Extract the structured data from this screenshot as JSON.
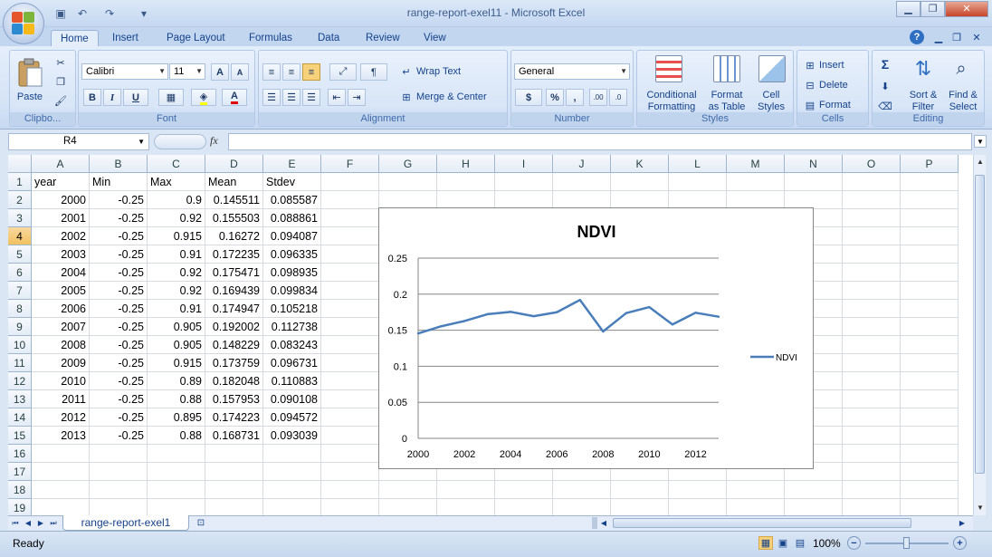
{
  "window": {
    "title": "range-report-exel11 - Microsoft Excel",
    "minimize": "▁",
    "restore": "❐",
    "close": "✕"
  },
  "tabs": [
    "Home",
    "Insert",
    "Page Layout",
    "Formulas",
    "Data",
    "Review",
    "View"
  ],
  "ribbon": {
    "clipboard": {
      "label": "Clipbo...",
      "paste": "Paste"
    },
    "font": {
      "label": "Font",
      "name": "Calibri",
      "size": "11",
      "bold": "B",
      "italic": "I",
      "underline": "U",
      "grow": "A",
      "shrink": "A",
      "fontcolor": "A"
    },
    "alignment": {
      "label": "Alignment",
      "wrap": "Wrap Text",
      "merge": "Merge & Center"
    },
    "number": {
      "label": "Number",
      "format": "General",
      "currency": "$",
      "percent": "%",
      "comma": ",",
      "inc": ".00",
      "dec": ".0"
    },
    "styles": {
      "label": "Styles",
      "conditional_1": "Conditional",
      "conditional_2": "Formatting",
      "table_1": "Format",
      "table_2": "as Table",
      "cell_1": "Cell",
      "cell_2": "Styles"
    },
    "cells": {
      "label": "Cells",
      "insert": "Insert",
      "delete": "Delete",
      "format": "Format"
    },
    "editing": {
      "label": "Editing",
      "sigma": "Σ",
      "sort_1": "Sort &",
      "sort_2": "Filter",
      "find_1": "Find &",
      "find_2": "Select"
    }
  },
  "formula_bar": {
    "name_box": "R4",
    "fx": "fx",
    "formula": ""
  },
  "columns": [
    "A",
    "B",
    "C",
    "D",
    "E",
    "F",
    "G",
    "H",
    "I",
    "J",
    "K",
    "L",
    "M",
    "N",
    "O",
    "P"
  ],
  "rows": [
    "1",
    "2",
    "3",
    "4",
    "5",
    "6",
    "7",
    "8",
    "9",
    "10",
    "11",
    "12",
    "13",
    "14",
    "15",
    "16",
    "17",
    "18",
    "19"
  ],
  "headers": [
    "year",
    "Min",
    "Max",
    "Mean",
    "Stdev"
  ],
  "table": [
    [
      "2000",
      "-0.25",
      "0.9",
      "0.145511",
      "0.085587"
    ],
    [
      "2001",
      "-0.25",
      "0.92",
      "0.155503",
      "0.088861"
    ],
    [
      "2002",
      "-0.25",
      "0.915",
      "0.16272",
      "0.094087"
    ],
    [
      "2003",
      "-0.25",
      "0.91",
      "0.172235",
      "0.096335"
    ],
    [
      "2004",
      "-0.25",
      "0.92",
      "0.175471",
      "0.098935"
    ],
    [
      "2005",
      "-0.25",
      "0.92",
      "0.169439",
      "0.099834"
    ],
    [
      "2006",
      "-0.25",
      "0.91",
      "0.174947",
      "0.105218"
    ],
    [
      "2007",
      "-0.25",
      "0.905",
      "0.192002",
      "0.112738"
    ],
    [
      "2008",
      "-0.25",
      "0.905",
      "0.148229",
      "0.083243"
    ],
    [
      "2009",
      "-0.25",
      "0.915",
      "0.173759",
      "0.096731"
    ],
    [
      "2010",
      "-0.25",
      "0.89",
      "0.182048",
      "0.110883"
    ],
    [
      "2011",
      "-0.25",
      "0.88",
      "0.157953",
      "0.090108"
    ],
    [
      "2012",
      "-0.25",
      "0.895",
      "0.174223",
      "0.094572"
    ],
    [
      "2013",
      "-0.25",
      "0.88",
      "0.168731",
      "0.093039"
    ]
  ],
  "chart_data": {
    "type": "line",
    "title": "NDVI",
    "x": [
      2000,
      2001,
      2002,
      2003,
      2004,
      2005,
      2006,
      2007,
      2008,
      2009,
      2010,
      2011,
      2012,
      2013
    ],
    "series": [
      {
        "name": "NDVI",
        "values": [
          0.145511,
          0.155503,
          0.16272,
          0.172235,
          0.175471,
          0.169439,
          0.174947,
          0.192002,
          0.148229,
          0.173759,
          0.182048,
          0.157953,
          0.174223,
          0.168731
        ]
      }
    ],
    "x_ticks": [
      "2000",
      "2002",
      "2004",
      "2006",
      "2008",
      "2010",
      "2012"
    ],
    "y_ticks": [
      "0",
      "0.05",
      "0.1",
      "0.15",
      "0.2",
      "0.25"
    ],
    "ylim": [
      0,
      0.25
    ],
    "grid": "horizontal",
    "legend": "right",
    "color": "#4a7ebb"
  },
  "sheet_tab": "range-report-exel1",
  "status": {
    "ready": "Ready",
    "zoom": "100%"
  }
}
